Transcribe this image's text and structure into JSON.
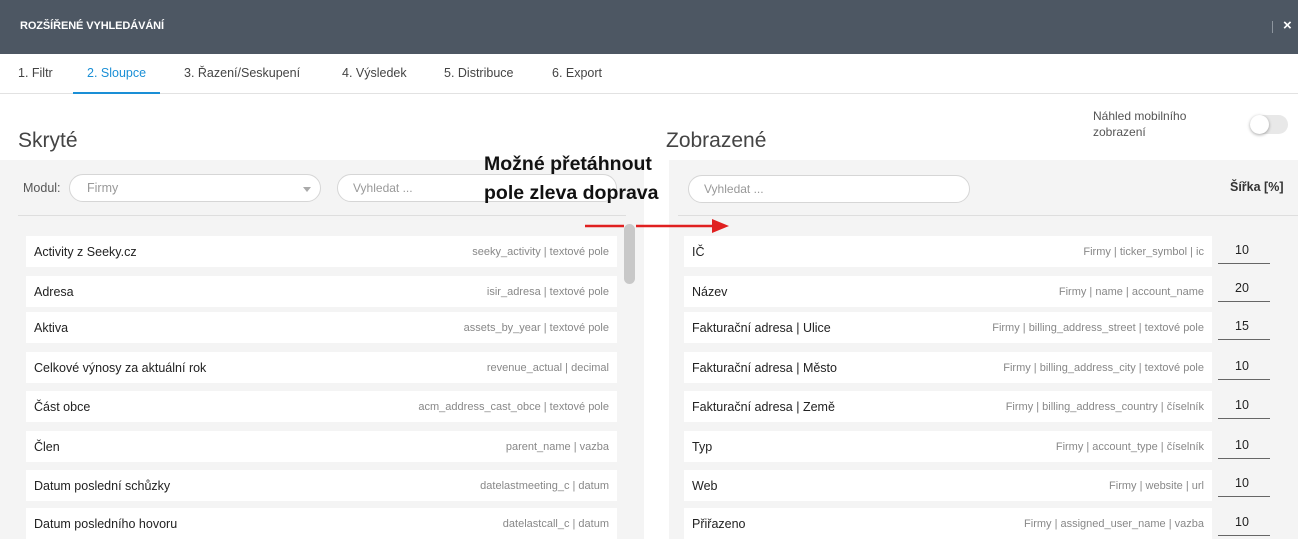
{
  "window": {
    "title": "ROZŠÍŘENÉ VYHLEDÁVÁNÍ",
    "close_glyph": "×"
  },
  "tabs": [
    {
      "label": "1. Filtr"
    },
    {
      "label": "2. Sloupce",
      "active": true
    },
    {
      "label": "3. Řazení/Seskupení"
    },
    {
      "label": "4. Výsledek"
    },
    {
      "label": "5. Distribuce"
    },
    {
      "label": "6. Export"
    }
  ],
  "hidden": {
    "heading": "Skryté",
    "modul_label": "Modul:",
    "modul_value": "Firmy",
    "search_placeholder": "Vyhledat ...",
    "items": [
      {
        "name": "Activity z Seeky.cz",
        "meta": "seeky_activity | textové pole"
      },
      {
        "name": "Adresa",
        "meta": "isir_adresa | textové pole"
      },
      {
        "name": "Aktiva",
        "meta": "assets_by_year | textové pole"
      },
      {
        "name": "Celkové výnosy za aktuální rok",
        "meta": "revenue_actual | decimal"
      },
      {
        "name": "Část obce",
        "meta": "acm_address_cast_obce | textové pole"
      },
      {
        "name": "Člen",
        "meta": "parent_name | vazba"
      },
      {
        "name": "Datum poslední schůzky",
        "meta": "datelastmeeting_c | datum"
      },
      {
        "name": "Datum posledního hovoru",
        "meta": "datelastcall_c | datum"
      }
    ]
  },
  "shown": {
    "heading": "Zobrazené",
    "search_placeholder": "Vyhledat ...",
    "width_header": "Šířka [%]",
    "items": [
      {
        "name": "IČ",
        "meta": "Firmy | ticker_symbol | ic",
        "width": "10"
      },
      {
        "name": "Název",
        "meta": "Firmy | name | account_name",
        "width": "20"
      },
      {
        "name": "Fakturační adresa | Ulice",
        "meta": "Firmy | billing_address_street | textové pole",
        "width": "15"
      },
      {
        "name": "Fakturační adresa | Město",
        "meta": "Firmy | billing_address_city | textové pole",
        "width": "10"
      },
      {
        "name": "Fakturační adresa | Země",
        "meta": "Firmy | billing_address_country | číselník",
        "width": "10"
      },
      {
        "name": "Typ",
        "meta": "Firmy | account_type | číselník",
        "width": "10"
      },
      {
        "name": "Web",
        "meta": "Firmy | website | url",
        "width": "10"
      },
      {
        "name": "Přiřazeno",
        "meta": "Firmy | assigned_user_name | vazba",
        "width": "10"
      }
    ]
  },
  "mobile_preview": {
    "label": "Náhled mobilního zobrazení",
    "enabled": false
  },
  "annotation": {
    "line1": "Možné přetáhnout",
    "line2": "pole zleva doprava",
    "arrow_color": "#e02020"
  },
  "colors": {
    "header_bg": "#4d5763",
    "accent": "#1a8fd6",
    "panel_bg": "#f4f4f4"
  }
}
